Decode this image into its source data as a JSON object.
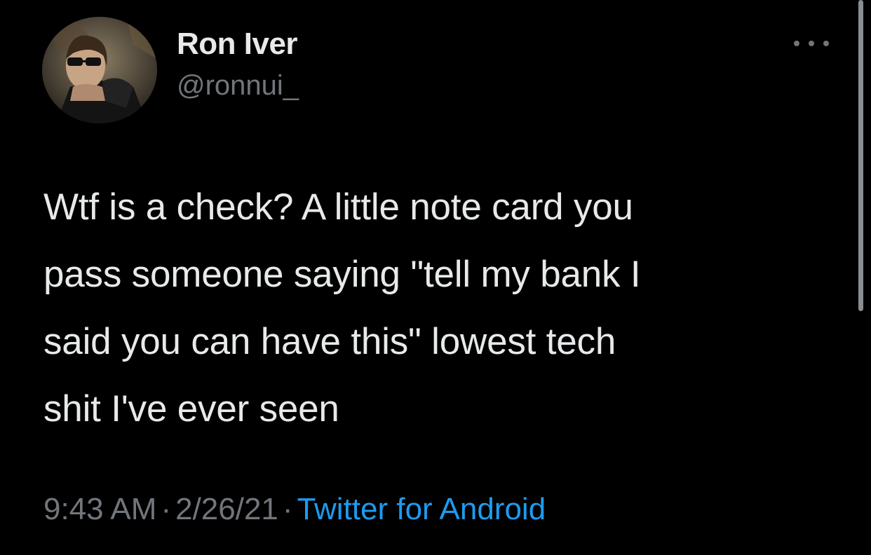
{
  "user": {
    "display_name": "Ron Iver",
    "handle": "@ronnui_",
    "avatar_icon": "profile-photo"
  },
  "tweet": {
    "lines": [
      "Wtf is a check? A little note card you",
      "pass someone saying \"tell my bank I",
      "said you can have this\" lowest tech",
      "shit I've ever seen"
    ]
  },
  "meta": {
    "time": "9:43 AM",
    "separator": "·",
    "date": "2/26/21",
    "source": "Twitter for Android"
  },
  "colors": {
    "background": "#000000",
    "text": "#e7e9ea",
    "muted": "#71767b",
    "link": "#1d9bf0"
  },
  "icons": {
    "more": "more-horizontal-icon"
  }
}
